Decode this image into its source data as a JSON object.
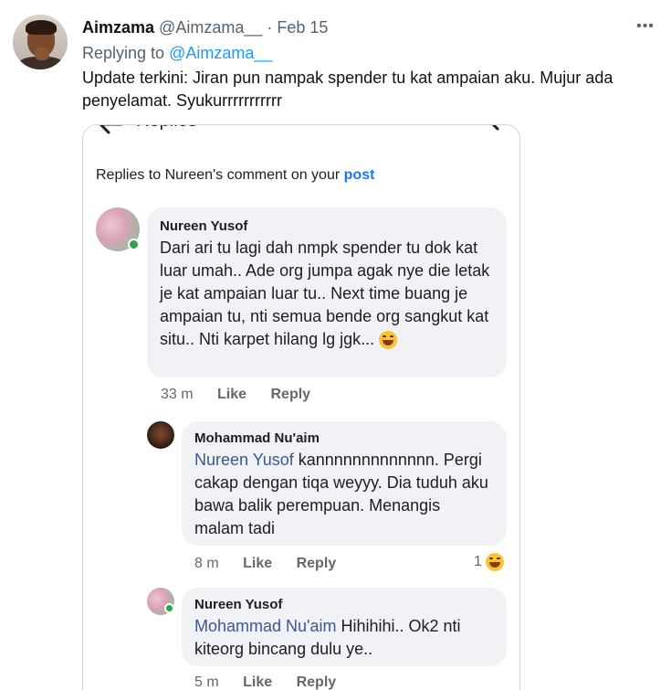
{
  "tweet": {
    "display_name": "Aimzama",
    "handle": "@Aimzama__",
    "separator": "·",
    "date": "Feb 15",
    "replying_prefix": "Replying to",
    "replying_to": "@Aimzama__",
    "text": "Update terkini: Jiran pun nampak spender tu kat ampaian aku. Mujur ada penyelamat. Syukurrrrrrrrrrr",
    "more_icon": "more-icon"
  },
  "fb": {
    "top_title": "Replies",
    "subhead_text": "Replies to Nureen's comment on your",
    "subhead_link": "post",
    "comments": [
      {
        "name": "Nureen Yusof",
        "text": "Dari ari tu lagi dah nmpk spender tu dok kat luar umah.. Ade org jumpa agak nye die letak je kat ampaian luar tu.. Next time buang je ampaian tu, nti semua bende org sangkut kat situ.. Nti karpet hilang lg jgk...",
        "time": "33 m",
        "like": "Like",
        "reply": "Reply"
      },
      {
        "name": "Mohammad Nu'aim",
        "tag": "Nureen Yusof",
        "text": " kannnnnnnnnnnnn. Pergi cakap dengan tiqa weyyy. Dia tuduh aku bawa balik perempuan. Menangis malam tadi",
        "time": "8 m",
        "like": "Like",
        "reply": "Reply",
        "reaction_count": "1"
      },
      {
        "name": "Nureen Yusof",
        "tag": "Mohammad Nu'aim",
        "text": " Hihihihi.. Ok2 nti kiteorg bincang dulu ye..",
        "time": "5 m",
        "like": "Like",
        "reply": "Reply"
      }
    ]
  },
  "colors": {
    "twitter_blue": "#1d9bf0",
    "fb_blue": "#1877f2",
    "fb_tag": "#385898",
    "bubble": "#f0f2f5",
    "online": "#31a24c"
  }
}
